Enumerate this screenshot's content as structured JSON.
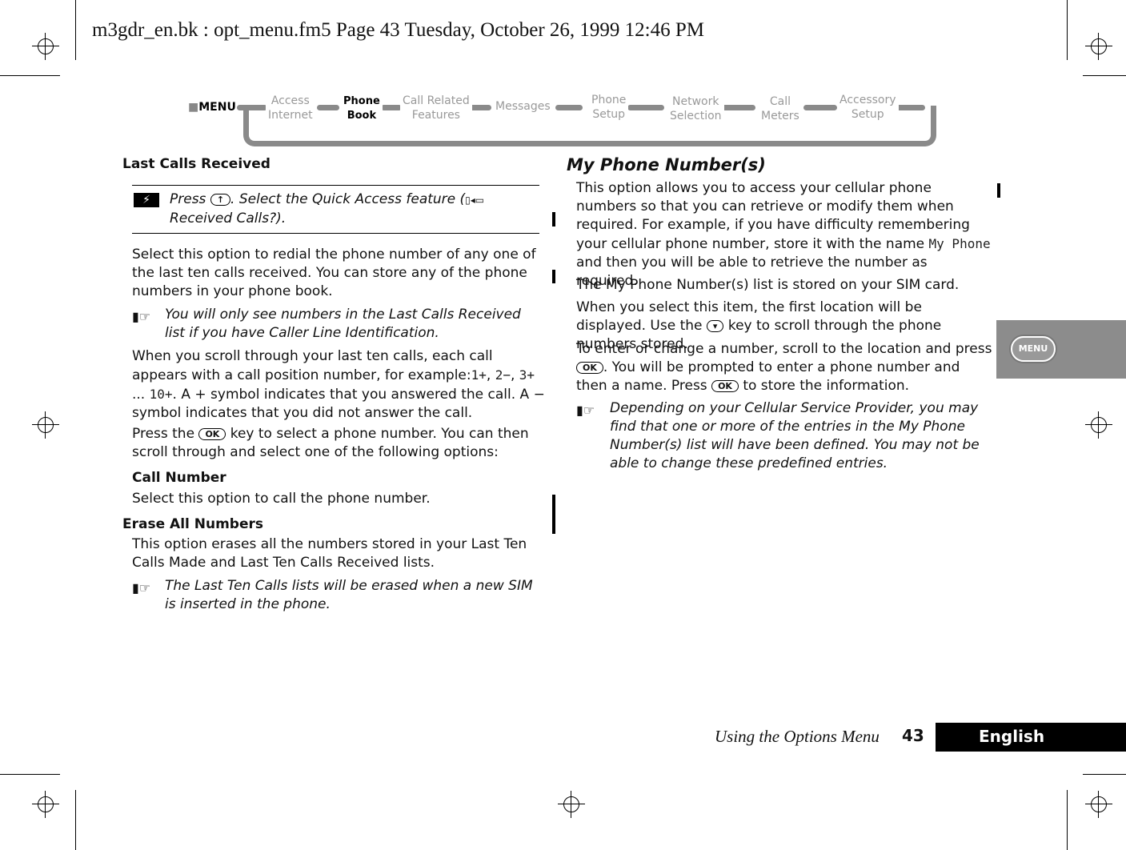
{
  "header": "m3gdr_en.bk : opt_menu.fm5  Page 43  Tuesday, October 26, 1999  12:46 PM",
  "nav": {
    "menu": "MENU",
    "items": [
      {
        "l1": "Access",
        "l2": "Internet"
      },
      {
        "l1": "Phone",
        "l2": "Book",
        "current": true
      },
      {
        "l1": "Call Related",
        "l2": "Features"
      },
      {
        "l1": "Messages",
        "l2": ""
      },
      {
        "l1": "Phone",
        "l2": "Setup"
      },
      {
        "l1": "Network",
        "l2": "Selection"
      },
      {
        "l1": "Call",
        "l2": "Meters"
      },
      {
        "l1": "Accessory",
        "l2": "Setup"
      }
    ]
  },
  "left": {
    "heading": "Last Calls Received",
    "quick": [
      {
        "t": "Press "
      },
      {
        "k": "↑"
      },
      {
        "t": ". Select the Quick Access feature ("
      },
      {
        "i": "▯◂▭"
      },
      {
        "t": " Received Calls?)."
      }
    ],
    "p1": [
      {
        "t": "Select this option to redial the phone number of any one of the last ten calls received. You can store any of the phone numbers in your phone book."
      }
    ],
    "note1": [
      {
        "t": "You will only see numbers in the Last Calls Received list if you have Caller Line Identification."
      }
    ],
    "p2": [
      {
        "t": "When you scroll through your last ten calls, each call appears with a call position number, for example:"
      },
      {
        "m": "1+"
      },
      {
        "t": ", "
      },
      {
        "m": "2−"
      },
      {
        "t": ", "
      },
      {
        "m": "3+"
      },
      {
        "t": " ... "
      },
      {
        "m": "10+"
      },
      {
        "t": ". A + symbol indicates that you answered the call. A −  symbol indicates that you did not answer the call."
      }
    ],
    "p3": [
      {
        "t": "Press the "
      },
      {
        "k": "OK"
      },
      {
        "t": " key to select a phone number. You can then scroll through and select one of the following options:"
      }
    ],
    "sub": "Call Number",
    "p4": [
      {
        "t": "Select this option to call the phone number."
      }
    ],
    "heading2": "Erase All Numbers",
    "p5": [
      {
        "t": "This option erases all the numbers stored in your Last Ten Calls Made and Last Ten Calls Received lists."
      }
    ],
    "note2": [
      {
        "t": "The Last Ten Calls lists will be erased when a new SIM is inserted in the phone."
      }
    ]
  },
  "right": {
    "heading": "My Phone Number(s)",
    "p1": [
      {
        "t": "This option allows you to access your cellular phone numbers so that you can retrieve or modify them when required. For example, if you have difficulty remembering your cellular phone number, store it with the name "
      },
      {
        "m": "My Phone"
      },
      {
        "t": " and then you will be able to retrieve the number as required."
      }
    ],
    "p2": [
      {
        "t": "The My Phone Number(s) list is stored on your SIM card."
      }
    ],
    "p3": [
      {
        "t": "When you select this item, the first location will be displayed. Use the "
      },
      {
        "k": "▾"
      },
      {
        "t": " key to scroll through the phone numbers stored."
      }
    ],
    "p4": [
      {
        "t": "To enter or change a number, scroll to the location and press "
      },
      {
        "k": "OK"
      },
      {
        "t": ". You will be prompted to enter a phone number and then a name. Press "
      },
      {
        "k": "OK"
      },
      {
        "t": " to store the information."
      }
    ],
    "note": [
      {
        "t": "Depending on your Cellular Service Provider, you may find that one or more of the entries in the My Phone Number(s) list will have been defined. You may not be able to change these predefined entries."
      }
    ]
  },
  "side_tab": "MENU",
  "footer": {
    "title": "Using the Options Menu",
    "page": "43",
    "language": "English"
  },
  "icons": {
    "quick_access": "quick-access-icon",
    "note": "pointing-hand-note-icon"
  },
  "colors": {
    "nav_gray": "#8a8a8a",
    "tab_gray": "#8c8c8c"
  }
}
